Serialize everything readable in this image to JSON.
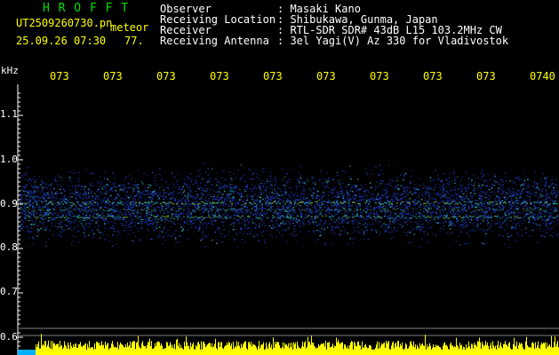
{
  "header": {
    "program_name": "H R O F F T",
    "filename": "UT2509260730.pn",
    "mode_label": "meteor",
    "datetime": "25.09.26 07:30",
    "count": "77.",
    "fields": [
      {
        "label": "Observer",
        "value": ": Masaki Kano"
      },
      {
        "label": "Receiving Location",
        "value": ": Shibukawa, Gunma, Japan"
      },
      {
        "label": "Receiver",
        "value": ": RTL-SDR SDR# 43dB L15 103.2MHz CW"
      },
      {
        "label": "Receiving Antenna",
        "value": ": 3el Yagi(V) Az 330 for Vladivostok"
      }
    ]
  },
  "axes": {
    "y_unit": "kHz",
    "y_ticks": [
      "1.1",
      "1.0",
      "0.9",
      "0.8",
      "0.7",
      "0.6"
    ],
    "x_ticks": [
      "073",
      "073",
      "073",
      "073",
      "073",
      "073",
      "073",
      "073",
      "073",
      "0740"
    ]
  },
  "colors": {
    "header_green": "#00e000",
    "header_white": "#ffffff",
    "header_yellow": "#ffff00",
    "tick_yellow": "#ffff00",
    "axis_white": "#ffffff",
    "signal_blue": "#1e3cc8",
    "signal_cyan": "#30d0c8",
    "bottom_bar": "#ffff00",
    "bottom_cyan": "#00b0ff"
  }
}
